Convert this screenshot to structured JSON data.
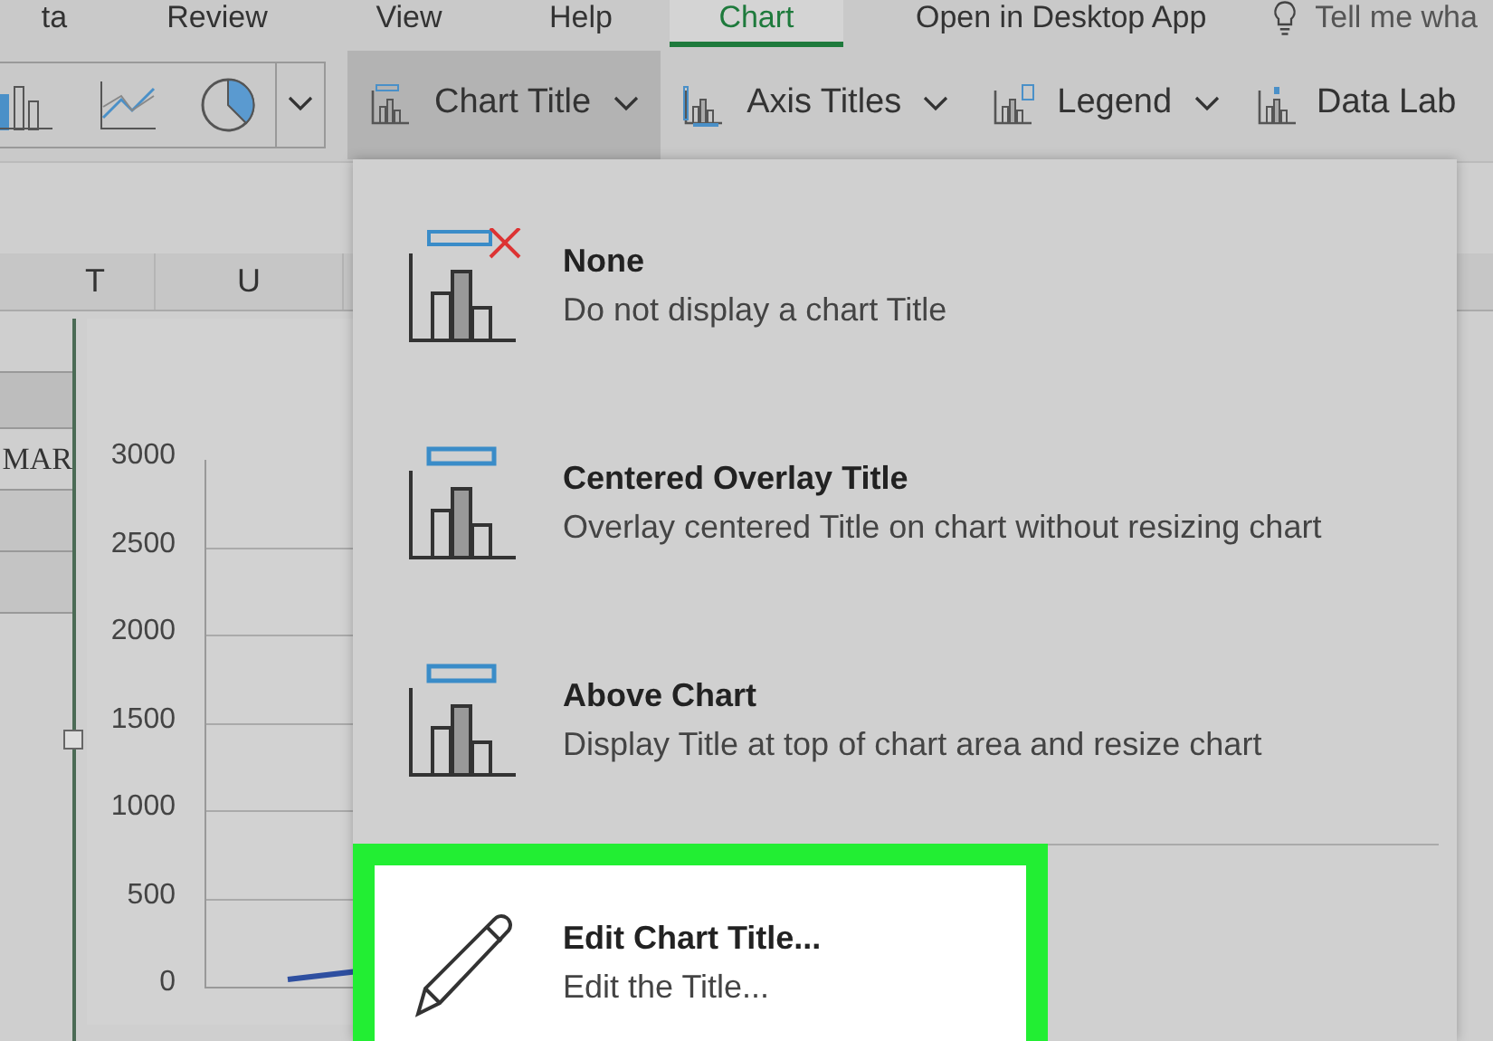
{
  "ribbon_tabs": [
    {
      "label": "ta",
      "selected": false
    },
    {
      "label": "Review",
      "selected": false
    },
    {
      "label": "View",
      "selected": false
    },
    {
      "label": "Help",
      "selected": false
    },
    {
      "label": "Chart",
      "selected": true
    }
  ],
  "open_desktop": "Open in Desktop App",
  "tell_me": {
    "placeholder": "Tell me wha"
  },
  "toolbar": [
    {
      "kind": "chart_types"
    },
    {
      "kind": "dropdown",
      "label": "Chart Title",
      "expanded": true
    },
    {
      "kind": "dropdown",
      "label": "Axis Titles"
    },
    {
      "kind": "dropdown",
      "label": "Legend"
    },
    {
      "kind": "label",
      "label": "Data Lab"
    }
  ],
  "sheet": {
    "columns": [
      "T",
      "U"
    ],
    "cells": [
      "MAR"
    ],
    "y_axis_labels": [
      "3000",
      "2500",
      "2000",
      "1500",
      "1000",
      "500",
      "0"
    ]
  },
  "menu": {
    "items": [
      {
        "kind": "none",
        "title": "None",
        "description": "Do not display a chart Title",
        "highlighted": false
      },
      {
        "kind": "overlay",
        "title": "Centered Overlay Title",
        "description": "Overlay centered Title on chart without resizing chart",
        "highlighted": false
      },
      {
        "kind": "above",
        "title": "Above Chart",
        "description": "Display Title at top of chart area and resize chart",
        "highlighted": false
      },
      {
        "kind": "edit",
        "title": "Edit Chart Title...",
        "description": "Edit the Title...",
        "highlighted": true
      }
    ]
  }
}
